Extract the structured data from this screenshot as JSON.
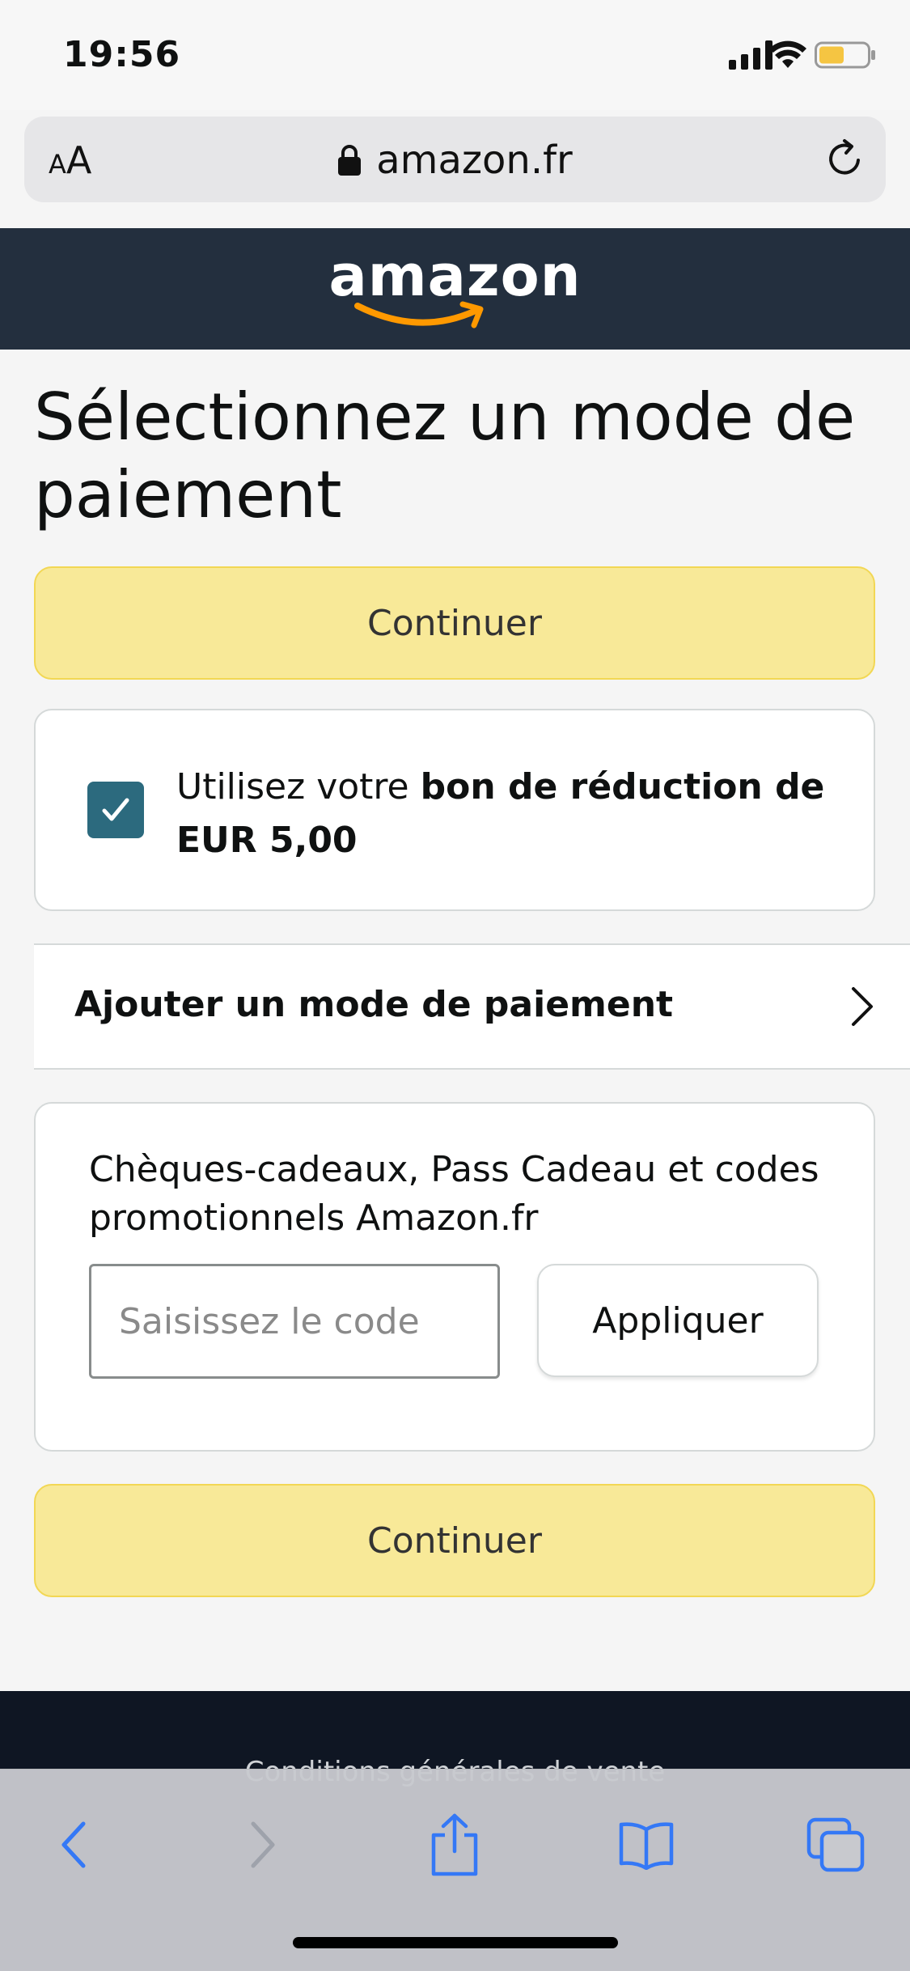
{
  "status_bar": {
    "time": "19:56",
    "icons": [
      "signal-icon",
      "wifi-icon",
      "battery-icon"
    ],
    "battery_color": "#f5c542"
  },
  "browser": {
    "text_size_label_small": "A",
    "text_size_label_large": "A",
    "url": "amazon.fr",
    "icons": [
      "lock-icon",
      "reload-icon"
    ]
  },
  "header": {
    "logo_text": "amazon",
    "background": "#232f3e",
    "accent": "#ff9900"
  },
  "main": {
    "title": "Sélectionnez un mode de paiement",
    "continue_label": "Continuer",
    "voucher": {
      "checked": true,
      "text_prefix": "Utilisez votre ",
      "text_bold": "bon de réduction de EUR 5,00"
    },
    "add_payment_label": "Ajouter un mode de paiement",
    "gift": {
      "label": "Chèques-cadeaux, Pass Cadeau et codes promotionnels Amazon.fr",
      "input_placeholder": "Saisissez le code",
      "input_value": "",
      "apply_label": "Appliquer"
    },
    "continue_bottom_label": "Continuer",
    "button_color": "#f8e998"
  },
  "footer": {
    "link": "Conditions générales de vente"
  },
  "toolbar": {
    "items": [
      "back-icon",
      "forward-icon",
      "share-icon",
      "bookmarks-icon",
      "tabs-icon"
    ],
    "accent": "#3478f6"
  }
}
